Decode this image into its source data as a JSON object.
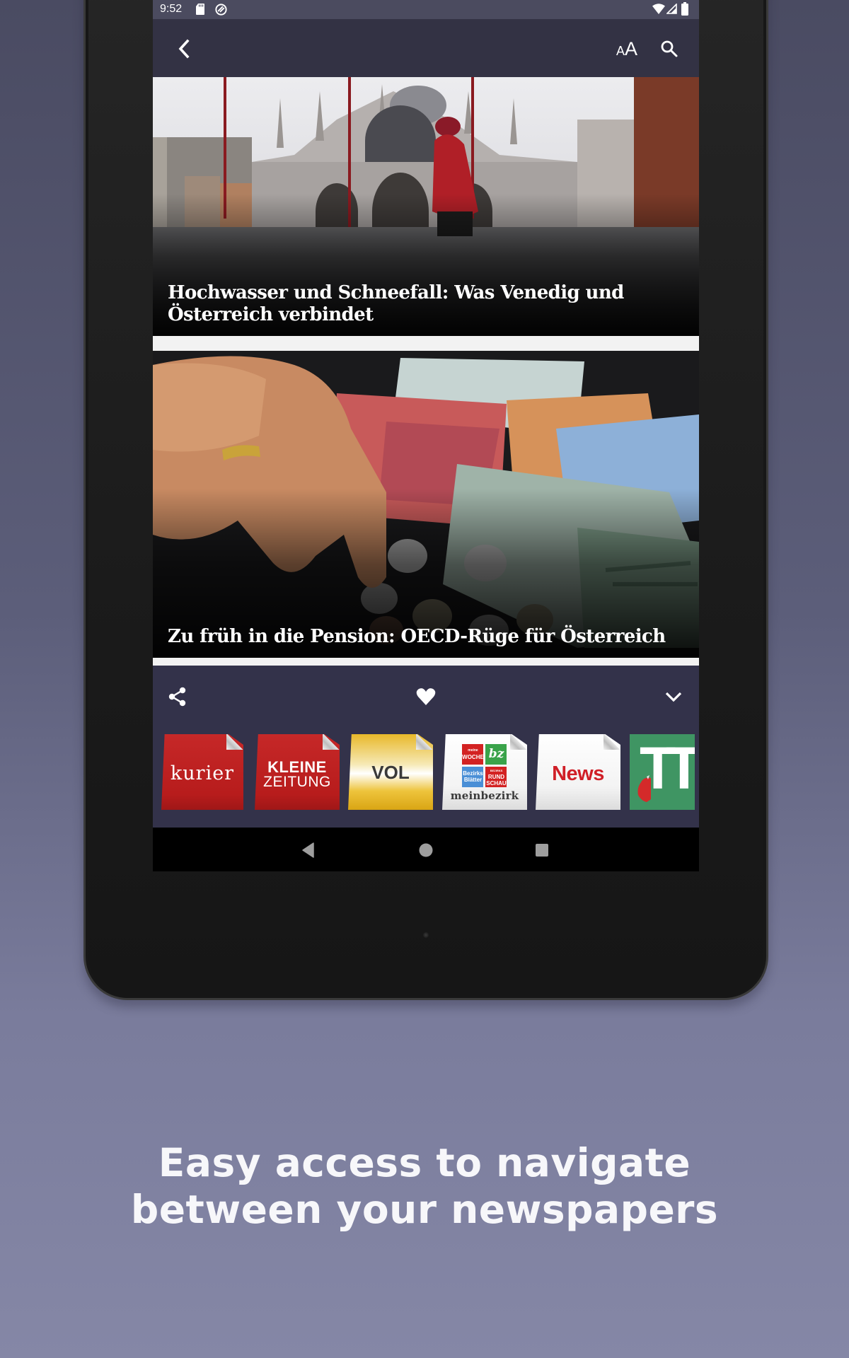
{
  "status_bar": {
    "time": "9:52",
    "icons": [
      "sd-card-icon",
      "sync-icon",
      "wifi-icon",
      "signal-icon",
      "battery-icon"
    ]
  },
  "app_bar": {
    "back_icon": "chevron-left-icon",
    "text_size_label": "AA",
    "search_icon": "search-icon"
  },
  "articles": [
    {
      "headline": "Hochwasser und Schneefall: Was Venedig und Österreich verbindet",
      "image": "Flooded St. Mark's Square in Venice, woman in red coat wading"
    },
    {
      "headline": "Zu früh in die Pension: OECD-Rüge für Österreich",
      "image": "Elderly hand counting euro coins next to euro banknotes"
    }
  ],
  "actions": {
    "share": "share-icon",
    "favorite": "heart-icon",
    "collapse": "chevron-down-icon"
  },
  "newspapers": [
    {
      "name": "kurier",
      "label": "kurier",
      "color": "#b71c1c"
    },
    {
      "name": "kleine-zeitung",
      "line1": "KLEINE",
      "line2": "ZEITUNG",
      "color": "#b71c1c"
    },
    {
      "name": "vol",
      "label": "VOL",
      "color": "#e6b52a"
    },
    {
      "name": "meinbezirk",
      "label": "meinbezirk",
      "tiles": [
        {
          "top": "meine",
          "main": "WOCHE"
        },
        {
          "main": "bz"
        },
        {
          "main": "Bezirks",
          "sub": "Blätter"
        },
        {
          "top": "BEZIRKS",
          "main": "RUND",
          "sub": "SCHAU"
        }
      ]
    },
    {
      "name": "news",
      "label": "News",
      "color": "#d01f27"
    },
    {
      "name": "tiroler-tageszeitung",
      "label": "TT",
      "color": "#3f9563"
    }
  ],
  "nav_bar": {
    "back": "nav-back-icon",
    "home": "nav-home-icon",
    "recents": "nav-recents-icon"
  },
  "caption": {
    "line1": "Easy access to navigate",
    "line2": "between your newspapers"
  }
}
